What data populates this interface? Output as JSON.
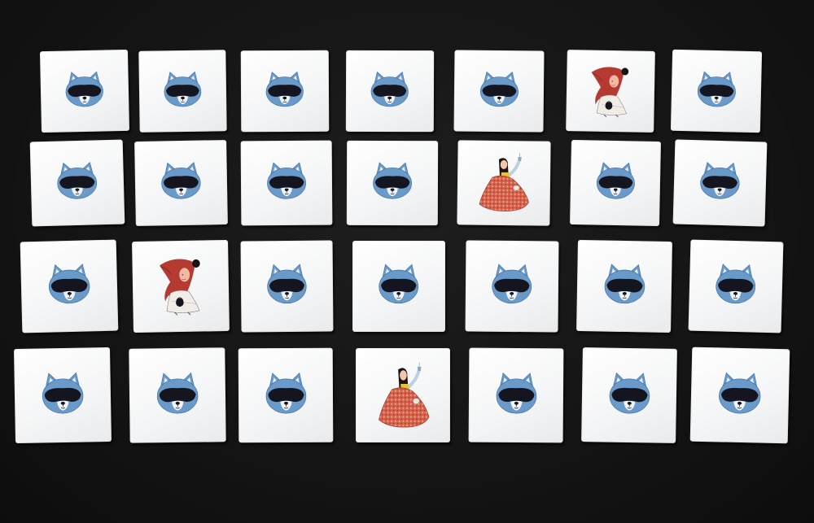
{
  "scene": {
    "colors": {
      "table": "#131313",
      "card": "#f6f7f8",
      "raccoon_fur": "#6f9fce",
      "raccoon_fur_dark": "#3f6f9f",
      "raccoon_mask": "#15151f",
      "hood_red": "#b53a32",
      "robe_orange": "#d7614a",
      "hair_black": "#1a1414"
    },
    "grid": {
      "rows": 4,
      "columns": 7
    },
    "cards": [
      {
        "row": 1,
        "col": 1,
        "image": "raccoon-face-icon"
      },
      {
        "row": 1,
        "col": 2,
        "image": "raccoon-face-icon"
      },
      {
        "row": 1,
        "col": 3,
        "image": "raccoon-face-icon"
      },
      {
        "row": 1,
        "col": 4,
        "image": "raccoon-face-icon"
      },
      {
        "row": 1,
        "col": 5,
        "image": "raccoon-face-icon"
      },
      {
        "row": 1,
        "col": 6,
        "image": "red-hood-girl-icon"
      },
      {
        "row": 1,
        "col": 7,
        "image": "raccoon-face-icon"
      },
      {
        "row": 2,
        "col": 1,
        "image": "raccoon-face-icon"
      },
      {
        "row": 2,
        "col": 2,
        "image": "raccoon-face-icon"
      },
      {
        "row": 2,
        "col": 3,
        "image": "raccoon-face-icon"
      },
      {
        "row": 2,
        "col": 4,
        "image": "raccoon-face-icon"
      },
      {
        "row": 2,
        "col": 5,
        "image": "seated-woman-icon"
      },
      {
        "row": 2,
        "col": 6,
        "image": "raccoon-face-icon"
      },
      {
        "row": 2,
        "col": 7,
        "image": "raccoon-face-icon"
      },
      {
        "row": 3,
        "col": 1,
        "image": "raccoon-face-icon"
      },
      {
        "row": 3,
        "col": 2,
        "image": "red-hood-girl-icon"
      },
      {
        "row": 3,
        "col": 3,
        "image": "raccoon-face-icon"
      },
      {
        "row": 3,
        "col": 4,
        "image": "raccoon-face-icon"
      },
      {
        "row": 3,
        "col": 5,
        "image": "raccoon-face-icon"
      },
      {
        "row": 3,
        "col": 6,
        "image": "raccoon-face-icon"
      },
      {
        "row": 3,
        "col": 7,
        "image": "raccoon-face-icon"
      },
      {
        "row": 4,
        "col": 1,
        "image": "raccoon-face-icon"
      },
      {
        "row": 4,
        "col": 2,
        "image": "raccoon-face-icon"
      },
      {
        "row": 4,
        "col": 3,
        "image": "raccoon-face-icon"
      },
      {
        "row": 4,
        "col": 4,
        "image": "seated-woman-icon"
      },
      {
        "row": 4,
        "col": 5,
        "image": "raccoon-face-icon"
      },
      {
        "row": 4,
        "col": 6,
        "image": "raccoon-face-icon"
      },
      {
        "row": 4,
        "col": 7,
        "image": "raccoon-face-icon"
      }
    ]
  }
}
